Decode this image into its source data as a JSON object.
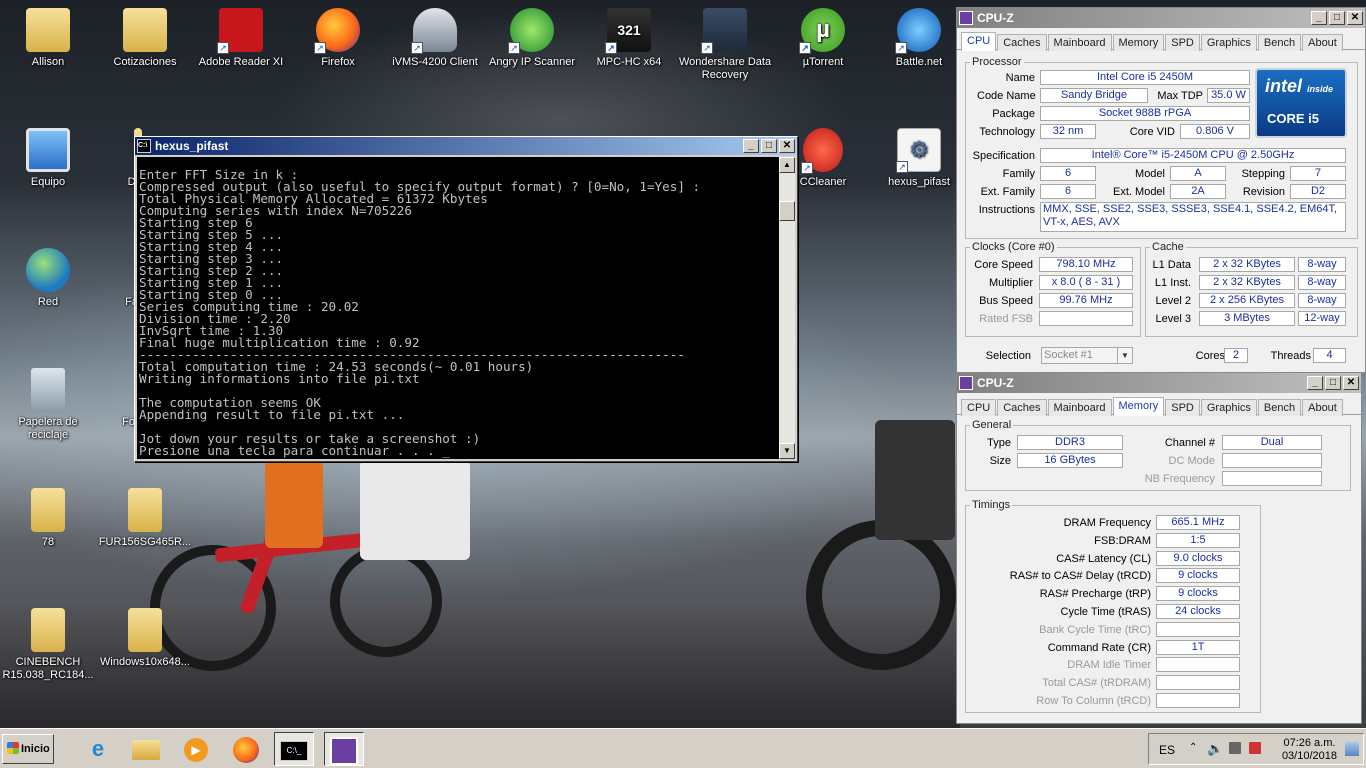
{
  "desktop": {
    "icons": [
      {
        "label": "Allison",
        "icon": "user-folder-icon"
      },
      {
        "label": "Cotizaciones",
        "icon": "folder-icon"
      },
      {
        "label": "Adobe Reader XI",
        "icon": "adobe-reader-icon"
      },
      {
        "label": "Firefox",
        "icon": "firefox-icon"
      },
      {
        "label": "iVMS-4200 Client",
        "icon": "ivms-camera-icon"
      },
      {
        "label": "Angry IP Scanner",
        "icon": "angry-ip-scanner-icon"
      },
      {
        "label": "MPC-HC x64",
        "icon": "mpc-hc-icon"
      },
      {
        "label": "Wondershare Data Recovery",
        "icon": "wondershare-icon"
      },
      {
        "label": "µTorrent",
        "icon": "utorrent-icon"
      },
      {
        "label": "Battle.net",
        "icon": "battlenet-icon"
      },
      {
        "label": "Equipo",
        "icon": "computer-icon"
      },
      {
        "label": "Di",
        "icon": "folder-icon"
      },
      {
        "label": "CCleaner",
        "icon": "ccleaner-icon"
      },
      {
        "label": "hexus_pifast",
        "icon": "hexus-pifast-icon"
      },
      {
        "label": "Red",
        "icon": "network-icon"
      },
      {
        "label": "Fa",
        "icon": "folder-icon"
      },
      {
        "label": "Papelera de reciclaje",
        "icon": "recycle-bin-icon"
      },
      {
        "label": "Fot",
        "icon": "folder-icon"
      },
      {
        "label": "78",
        "icon": "folder-icon"
      },
      {
        "label": "FUR156SG465R...",
        "icon": "folder-icon"
      },
      {
        "label": "CINEBENCH R15.038_RC184...",
        "icon": "folder-icon"
      },
      {
        "label": "Windows10x648...",
        "icon": "folder-icon"
      }
    ]
  },
  "console": {
    "title": "hexus_pifast",
    "lines": [
      "Enter FFT Size in k :",
      "Compressed output (also useful to specify output format) ? [0=No, 1=Yes] :",
      "Total Physical Memory Allocated = 61372 Kbytes",
      "Computing series with index N=705226",
      "Starting step 6",
      "Starting step 5 ...",
      "Starting step 4 ...",
      "Starting step 3 ...",
      "Starting step 2 ...",
      "Starting step 1 ...",
      "Starting step 0 ...",
      "Series computing time : 20.02",
      "Division time : 2.20",
      "InvSqrt time : 1.30",
      "Final huge multiplication time : 0.92",
      "------------------------------------------------------------------------",
      "Total computation time : 24.53 seconds(~ 0.01 hours)",
      "Writing informations into file pi.txt",
      "",
      "The computation seems OK",
      "Appending result to file pi.txt ...",
      "",
      "Jot down your results or take a screenshot :)",
      "Presione una tecla para continuar . . . _"
    ]
  },
  "cpuz1": {
    "title": "CPU-Z",
    "tabs": [
      "CPU",
      "Caches",
      "Mainboard",
      "Memory",
      "SPD",
      "Graphics",
      "Bench",
      "About"
    ],
    "processor": {
      "legend": "Processor",
      "name_label": "Name",
      "name": "Intel Core i5 2450M",
      "codename_label": "Code Name",
      "codename": "Sandy Bridge",
      "maxtdp_label": "Max TDP",
      "maxtdp": "35.0 W",
      "package_label": "Package",
      "package": "Socket 988B rPGA",
      "tech_label": "Technology",
      "tech": "32 nm",
      "corevid_label": "Core VID",
      "corevid": "0.806 V",
      "spec_label": "Specification",
      "spec": "Intel® Core™ i5-2450M CPU @ 2.50GHz",
      "family_label": "Family",
      "family": "6",
      "model_label": "Model",
      "model": "A",
      "stepping_label": "Stepping",
      "stepping": "7",
      "extfamily_label": "Ext. Family",
      "extfamily": "6",
      "extmodel_label": "Ext. Model",
      "extmodel": "2A",
      "revision_label": "Revision",
      "revision": "D2",
      "instr_label": "Instructions",
      "instr": "MMX, SSE, SSE2, SSE3, SSSE3, SSE4.1, SSE4.2, EM64T, VT-x, AES, AVX",
      "logo_text1": "intel",
      "logo_text2": "inside",
      "logo_text3": "CORE i5"
    },
    "clocks": {
      "legend": "Clocks (Core #0)",
      "speed_label": "Core Speed",
      "speed": "798.10 MHz",
      "mult_label": "Multiplier",
      "mult": "x 8.0 ( 8 - 31 )",
      "bus_label": "Bus Speed",
      "bus": "99.76 MHz",
      "fsb_label": "Rated FSB",
      "fsb": ""
    },
    "cache": {
      "legend": "Cache",
      "l1d_label": "L1 Data",
      "l1d": "2 x 32 KBytes",
      "l1d_way": "8-way",
      "l1i_label": "L1 Inst.",
      "l1i": "2 x 32 KBytes",
      "l1i_way": "8-way",
      "l2_label": "Level 2",
      "l2": "2 x 256 KBytes",
      "l2_way": "8-way",
      "l3_label": "Level 3",
      "l3": "3 MBytes",
      "l3_way": "12-way"
    },
    "selection_label": "Selection",
    "selection": "Socket #1",
    "cores_label": "Cores",
    "cores": "2",
    "threads_label": "Threads",
    "threads": "4"
  },
  "cpuz2": {
    "title": "CPU-Z",
    "tabs": [
      "CPU",
      "Caches",
      "Mainboard",
      "Memory",
      "SPD",
      "Graphics",
      "Bench",
      "About"
    ],
    "general": {
      "legend": "General",
      "type_label": "Type",
      "type": "DDR3",
      "size_label": "Size",
      "size": "16 GBytes",
      "channel_label": "Channel #",
      "channel": "Dual",
      "dcmode_label": "DC Mode",
      "dcmode": "",
      "nbfreq_label": "NB Frequency",
      "nbfreq": ""
    },
    "timings": {
      "legend": "Timings",
      "rows": [
        {
          "label": "DRAM Frequency",
          "value": "665.1 MHz",
          "dim": false
        },
        {
          "label": "FSB:DRAM",
          "value": "1:5",
          "dim": false
        },
        {
          "label": "CAS# Latency (CL)",
          "value": "9.0 clocks",
          "dim": false
        },
        {
          "label": "RAS# to CAS# Delay (tRCD)",
          "value": "9 clocks",
          "dim": false
        },
        {
          "label": "RAS# Precharge (tRP)",
          "value": "9 clocks",
          "dim": false
        },
        {
          "label": "Cycle Time (tRAS)",
          "value": "24 clocks",
          "dim": false
        },
        {
          "label": "Bank Cycle Time (tRC)",
          "value": "",
          "dim": true
        },
        {
          "label": "Command Rate (CR)",
          "value": "1T",
          "dim": false
        },
        {
          "label": "DRAM Idle Timer",
          "value": "",
          "dim": true
        },
        {
          "label": "Total CAS# (tRDRAM)",
          "value": "",
          "dim": true
        },
        {
          "label": "Row To Column (tRCD)",
          "value": "",
          "dim": true
        }
      ]
    }
  },
  "taskbar": {
    "start_label": "Inicio",
    "apps": [
      "internet-explorer-icon",
      "file-explorer-icon",
      "media-player-icon",
      "firefox-icon",
      "console-icon",
      "cpuz-icon"
    ],
    "lang": "ES",
    "time": "07:26 a.m.",
    "date": "03/10/2018"
  },
  "colors": {
    "titlebar_active": "#0a246a",
    "titlebar_inactive": "#808080",
    "cpuz_value_text": "#1a2fa0",
    "console_bg": "#000000"
  }
}
